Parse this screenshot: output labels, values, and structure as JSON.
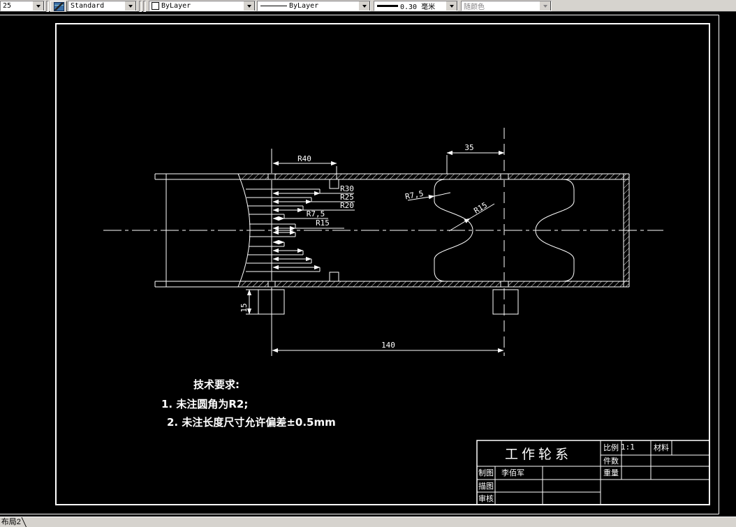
{
  "toolbar": {
    "unknown_combo_value": "25",
    "text_style_combo": "Standard",
    "color_combo": "ByLayer",
    "linetype_combo": "ByLayer",
    "lineweight_combo": "0.30 毫米",
    "plotstyle_combo": "随颜色"
  },
  "drawing": {
    "dimensions": {
      "r40": "R40",
      "r30": "R30",
      "r25": "R25",
      "r20": "R20",
      "r7_5": "R7,5",
      "r15": "R15",
      "groove_r7_5": "R7,5",
      "groove_r15": "R15",
      "len35": "35",
      "len140": "140",
      "len15": "15"
    },
    "tech_requirements": {
      "heading": "技术要求:",
      "item1": "1. 未注圆角为R2;",
      "item2": "2. 未注长度尺寸允许偏差±0.5mm"
    },
    "title_block": {
      "title": "工作轮系",
      "scale_label": "比例",
      "scale_value": "1:1",
      "material_label": "材料",
      "qty_label": "件数",
      "weight_label": "重量",
      "drawn_label": "制图",
      "drawn_by": "李佰军",
      "traced_label": "描图",
      "checked_label": "审核"
    }
  },
  "statusbar": {
    "layout_tab": "布局2"
  },
  "colors": {
    "toolbar_bg": "#d6d3ce",
    "canvas_bg": "#000000",
    "line": "#ffffff",
    "disabled_text": "#848284"
  }
}
